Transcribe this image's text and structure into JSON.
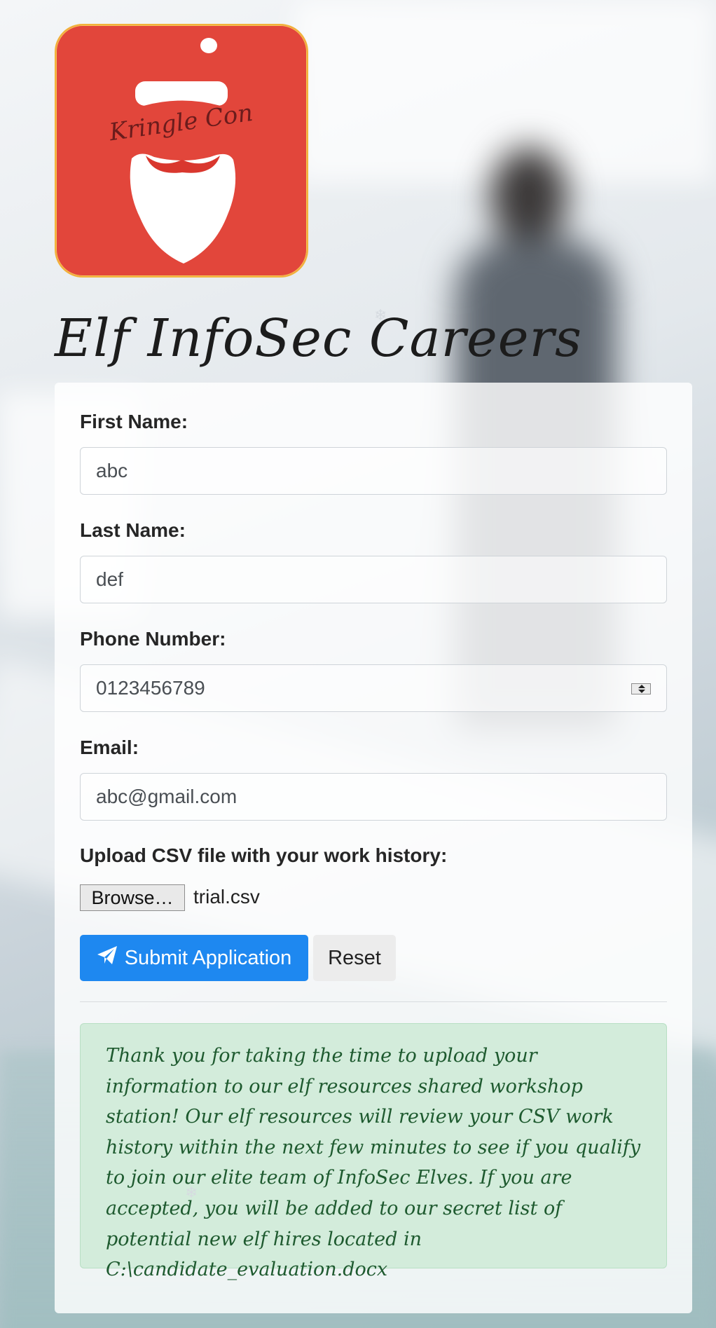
{
  "site": {
    "title": "Elf InfoSec Careers",
    "logo_text": "Kringle Con"
  },
  "form": {
    "first_name": {
      "label": "First Name:",
      "value": "abc"
    },
    "last_name": {
      "label": "Last Name:",
      "value": "def"
    },
    "phone": {
      "label": "Phone Number:",
      "value": "0123456789"
    },
    "email": {
      "label": "Email:",
      "value": "abc@gmail.com"
    },
    "upload": {
      "label": "Upload CSV file with your work history:",
      "browse_label": "Browse…",
      "file_name": "trial.csv"
    },
    "submit_label": "Submit Application",
    "reset_label": "Reset"
  },
  "notice": {
    "text": "Thank you for taking the time to upload your information to our elf resources shared workshop station! Our elf resources will review your CSV work history within the next few minutes to see if you qualify to join our elite team of InfoSec Elves. If you are accepted, you will be added to our secret list of potential new elf hires located in C:\\candidate_evaluation.docx"
  },
  "icons": {
    "submit": "paper-plane-icon",
    "snowflake": "snowflake-icon"
  },
  "colors": {
    "logo_bg": "#e2463b",
    "primary": "#1e88f0",
    "notice_bg": "#d3ecdb",
    "notice_text": "#1e5a2f"
  }
}
